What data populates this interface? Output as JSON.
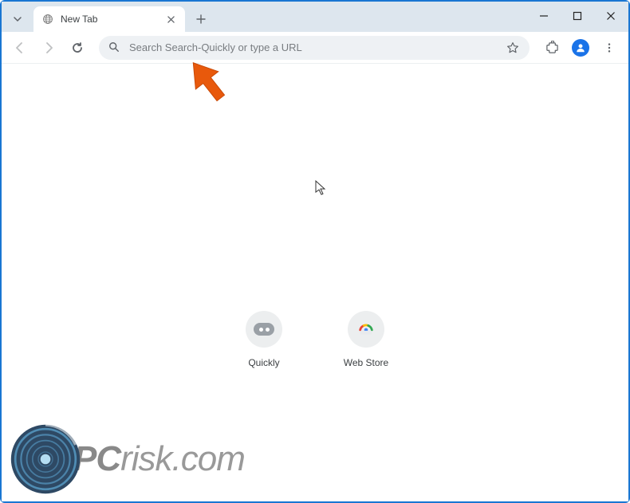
{
  "tab": {
    "title": "New Tab"
  },
  "omnibox": {
    "placeholder": "Search Search-Quickly or type a URL"
  },
  "shortcuts": [
    {
      "label": "Quickly"
    },
    {
      "label": "Web Store"
    }
  ],
  "watermark": {
    "brand_prefix": "PC",
    "brand_suffix": "risk.com"
  }
}
